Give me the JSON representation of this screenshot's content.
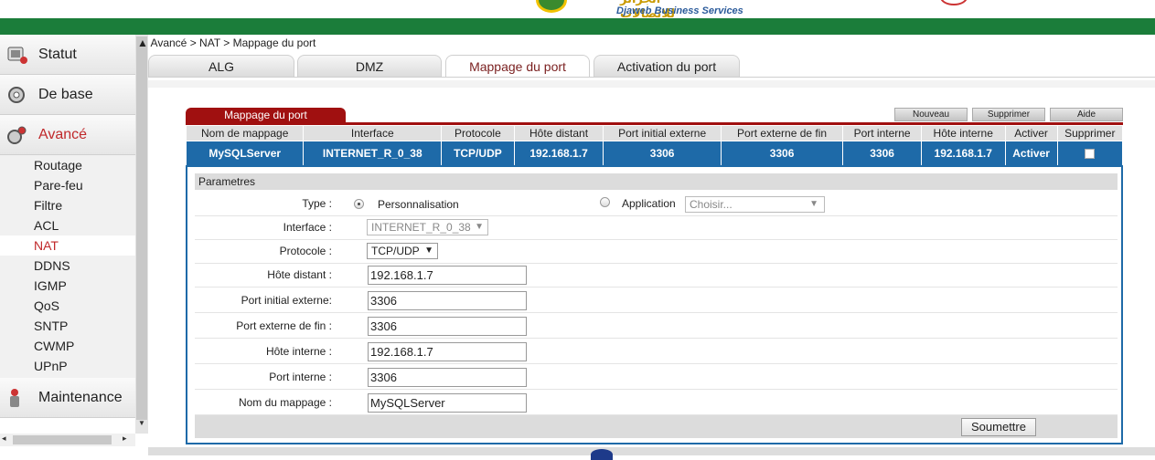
{
  "header": {
    "brand_arabic": "الجزائر للاتصالات",
    "brand_text": "Djaweb Business Services"
  },
  "sidebar": {
    "main": [
      {
        "label": "Statut",
        "icon": "status-icon"
      },
      {
        "label": "De base",
        "icon": "basic-settings-icon"
      },
      {
        "label": "Avancé",
        "icon": "advanced-settings-icon",
        "active": true
      },
      {
        "label": "Maintenance",
        "icon": "maintenance-icon"
      }
    ],
    "submenu": [
      "Routage",
      "Pare-feu",
      "Filtre",
      "ACL",
      "NAT",
      "DDNS",
      "IGMP",
      "QoS",
      "SNTP",
      "CWMP",
      "UPnP"
    ],
    "selected_submenu": "NAT"
  },
  "breadcrumb": "▲ Avancé > NAT > Mappage du port",
  "tabs": [
    "ALG",
    "DMZ",
    "Mappage du port",
    "Activation du port"
  ],
  "active_tab": "Mappage du port",
  "section": {
    "title": "Mappage du port",
    "buttons": {
      "new": "Nouveau",
      "delete": "Supprimer",
      "help": "Aide"
    }
  },
  "table": {
    "headers": [
      "Nom de mappage",
      "Interface",
      "Protocole",
      "Hôte distant",
      "Port initial externe",
      "Port externe de fin",
      "Port interne",
      "Hôte interne",
      "Activer",
      "Supprimer"
    ],
    "rows": [
      [
        "MySQLServer",
        "INTERNET_R_0_38",
        "TCP/UDP",
        "192.168.1.7",
        "3306",
        "3306",
        "3306",
        "192.168.1.7",
        "Activer",
        ""
      ]
    ]
  },
  "params": {
    "title": "Parametres",
    "type_label": "Type :",
    "type_custom": "Personnalisation",
    "type_app": "Application",
    "app_placeholder": "Choisir...",
    "interface_label": "Interface :",
    "interface_value": "INTERNET_R_0_38",
    "protocol_label": "Protocole :",
    "protocol_value": "TCP/UDP",
    "remote_host_label": "Hôte distant :",
    "remote_host_value": "192.168.1.7",
    "ext_start_label": "Port initial externe:",
    "ext_start_value": "3306",
    "ext_end_label": "Port externe de fin :",
    "ext_end_value": "3306",
    "internal_host_label": "Hôte interne :",
    "internal_host_value": "192.168.1.7",
    "internal_port_label": "Port interne :",
    "internal_port_value": "3306",
    "mapping_name_label": "Nom du mappage :",
    "mapping_name_value": "MySQLServer",
    "submit": "Soumettre"
  }
}
